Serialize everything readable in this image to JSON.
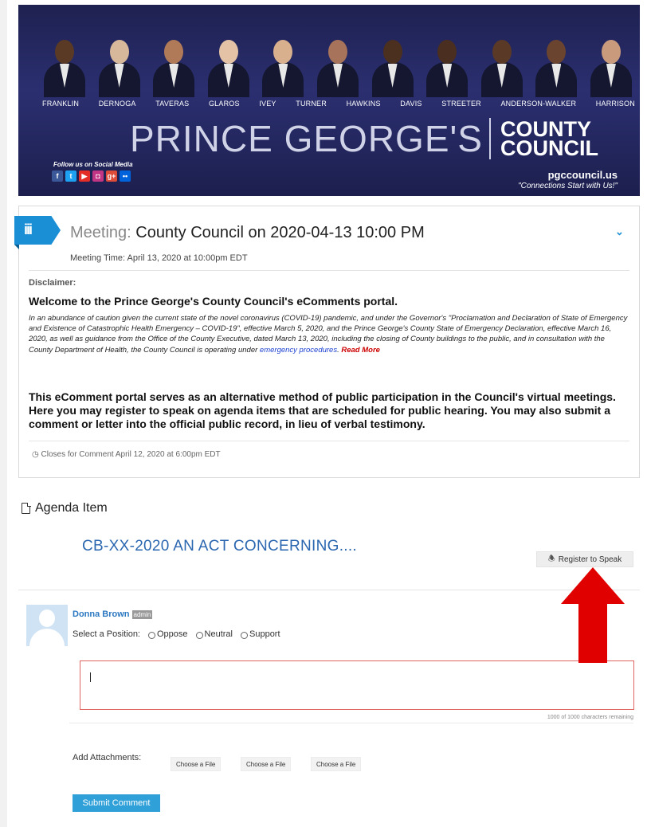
{
  "banner": {
    "members": [
      "FRANKLIN",
      "DERNOGA",
      "TAVERAS",
      "GLAROS",
      "IVEY",
      "TURNER",
      "HAWKINS",
      "DAVIS",
      "STREETER",
      "ANDERSON-WALKER",
      "HARRISON"
    ],
    "title_left": "PRINCE GEORGE'S",
    "title_right_1": "COUNTY",
    "title_right_2": "COUNCIL",
    "social_label": "Follow us on Social Media",
    "site": "pgccouncil.us",
    "tagline": "\"Connections Start with Us!\"",
    "skin_tones": [
      "#5a3a24",
      "#d8b89a",
      "#b07a58",
      "#e3c2a5",
      "#d9b08e",
      "#a7735a",
      "#4b2f1f",
      "#4a2e1f",
      "#5a3a26",
      "#6b4430",
      "#c99a7c"
    ]
  },
  "meeting": {
    "label": "Meeting:",
    "title": "County Council on 2020-04-13 10:00 PM",
    "time": "Meeting Time: April 13, 2020 at 10:00pm EDT",
    "disclaimer": "Disclaimer:",
    "welcome": "Welcome to the Prince George's County Council's eComments portal.",
    "intro": "In an abundance of caution given the current state of the novel coronavirus (COVID-19) pandemic, and under the Governor's \"Proclamation and Declaration of State of Emergency and Existence of Catastrophic Health Emergency – COVID-19\", effective March 5, 2020, and the Prince George's County State of Emergency Declaration, effective March 16, 2020, as well as guidance from the Office of the County Executive, dated March 13, 2020, including the closing of County buildings to the public, and in consultation with the County Department of Health, the County Council is operating under ",
    "intro_link": "emergency procedures",
    "intro_period": ".",
    "read_more": "Read More",
    "portal": "This eComment portal serves as an alternative method of public participation in the Council's virtual meetings.  Here you may register to speak on agenda items that are scheduled for public hearing. You may also submit a comment or letter into the official public record, in lieu of verbal testimony.",
    "closes": "Closes for Comment April 12, 2020 at 6:00pm EDT"
  },
  "agenda": {
    "heading": "Agenda Item",
    "title": "CB-XX-2020 AN ACT CONCERNING....",
    "register_label": "Register to Speak"
  },
  "comment": {
    "user": "Donna Brown",
    "badge": "admin",
    "position_label": "Select a Position:",
    "options": [
      "Oppose",
      "Neutral",
      "Support"
    ],
    "remaining": "1000 of 1000 characters remaining",
    "attach_label": "Add Attachments:",
    "file_button": "Choose a File",
    "submit": "Submit Comment"
  },
  "colors": {
    "accent": "#1a8fd6",
    "link": "#2b67b0",
    "arrow": "#e00000"
  }
}
